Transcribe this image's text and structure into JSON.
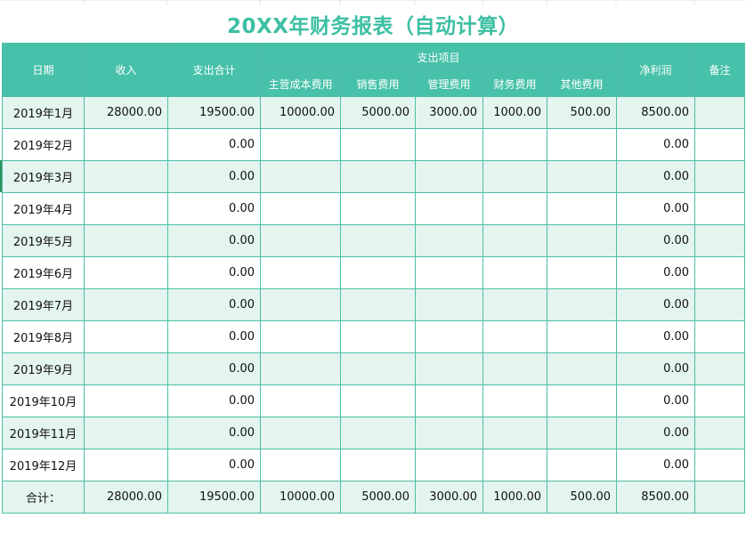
{
  "title": "20XX年财务报表（自动计算）",
  "headers": {
    "date": "日期",
    "income": "收入",
    "expense_total": "支出合计",
    "expense_items_group": "支出项目",
    "main_cost": "主营成本费用",
    "sales_cost": "销售费用",
    "admin_cost": "管理费用",
    "finance_cost": "财务费用",
    "other_cost": "其他费用",
    "net_profit": "净利润",
    "notes": "备注"
  },
  "rows": [
    {
      "date": "2019年1月",
      "income": "28000.00",
      "expense_total": "19500.00",
      "main_cost": "10000.00",
      "sales_cost": "5000.00",
      "admin_cost": "3000.00",
      "finance_cost": "1000.00",
      "other_cost": "500.00",
      "net_profit": "8500.00",
      "notes": ""
    },
    {
      "date": "2019年2月",
      "income": "",
      "expense_total": "0.00",
      "main_cost": "",
      "sales_cost": "",
      "admin_cost": "",
      "finance_cost": "",
      "other_cost": "",
      "net_profit": "0.00",
      "notes": ""
    },
    {
      "date": "2019年3月",
      "income": "",
      "expense_total": "0.00",
      "main_cost": "",
      "sales_cost": "",
      "admin_cost": "",
      "finance_cost": "",
      "other_cost": "",
      "net_profit": "0.00",
      "notes": ""
    },
    {
      "date": "2019年4月",
      "income": "",
      "expense_total": "0.00",
      "main_cost": "",
      "sales_cost": "",
      "admin_cost": "",
      "finance_cost": "",
      "other_cost": "",
      "net_profit": "0.00",
      "notes": ""
    },
    {
      "date": "2019年5月",
      "income": "",
      "expense_total": "0.00",
      "main_cost": "",
      "sales_cost": "",
      "admin_cost": "",
      "finance_cost": "",
      "other_cost": "",
      "net_profit": "0.00",
      "notes": ""
    },
    {
      "date": "2019年6月",
      "income": "",
      "expense_total": "0.00",
      "main_cost": "",
      "sales_cost": "",
      "admin_cost": "",
      "finance_cost": "",
      "other_cost": "",
      "net_profit": "0.00",
      "notes": ""
    },
    {
      "date": "2019年7月",
      "income": "",
      "expense_total": "0.00",
      "main_cost": "",
      "sales_cost": "",
      "admin_cost": "",
      "finance_cost": "",
      "other_cost": "",
      "net_profit": "0.00",
      "notes": ""
    },
    {
      "date": "2019年8月",
      "income": "",
      "expense_total": "0.00",
      "main_cost": "",
      "sales_cost": "",
      "admin_cost": "",
      "finance_cost": "",
      "other_cost": "",
      "net_profit": "0.00",
      "notes": ""
    },
    {
      "date": "2019年9月",
      "income": "",
      "expense_total": "0.00",
      "main_cost": "",
      "sales_cost": "",
      "admin_cost": "",
      "finance_cost": "",
      "other_cost": "",
      "net_profit": "0.00",
      "notes": ""
    },
    {
      "date": "2019年10月",
      "income": "",
      "expense_total": "0.00",
      "main_cost": "",
      "sales_cost": "",
      "admin_cost": "",
      "finance_cost": "",
      "other_cost": "",
      "net_profit": "0.00",
      "notes": ""
    },
    {
      "date": "2019年11月",
      "income": "",
      "expense_total": "0.00",
      "main_cost": "",
      "sales_cost": "",
      "admin_cost": "",
      "finance_cost": "",
      "other_cost": "",
      "net_profit": "0.00",
      "notes": ""
    },
    {
      "date": "2019年12月",
      "income": "",
      "expense_total": "0.00",
      "main_cost": "",
      "sales_cost": "",
      "admin_cost": "",
      "finance_cost": "",
      "other_cost": "",
      "net_profit": "0.00",
      "notes": ""
    }
  ],
  "total": {
    "date": "合计：",
    "income": "28000.00",
    "expense_total": "19500.00",
    "main_cost": "10000.00",
    "sales_cost": "5000.00",
    "admin_cost": "3000.00",
    "finance_cost": "1000.00",
    "other_cost": "500.00",
    "net_profit": "8500.00",
    "notes": ""
  },
  "colors": {
    "accent": "#47c1a9",
    "title": "#3dbfa3",
    "band": "#e4f4ef",
    "border": "#4cbfa8"
  }
}
